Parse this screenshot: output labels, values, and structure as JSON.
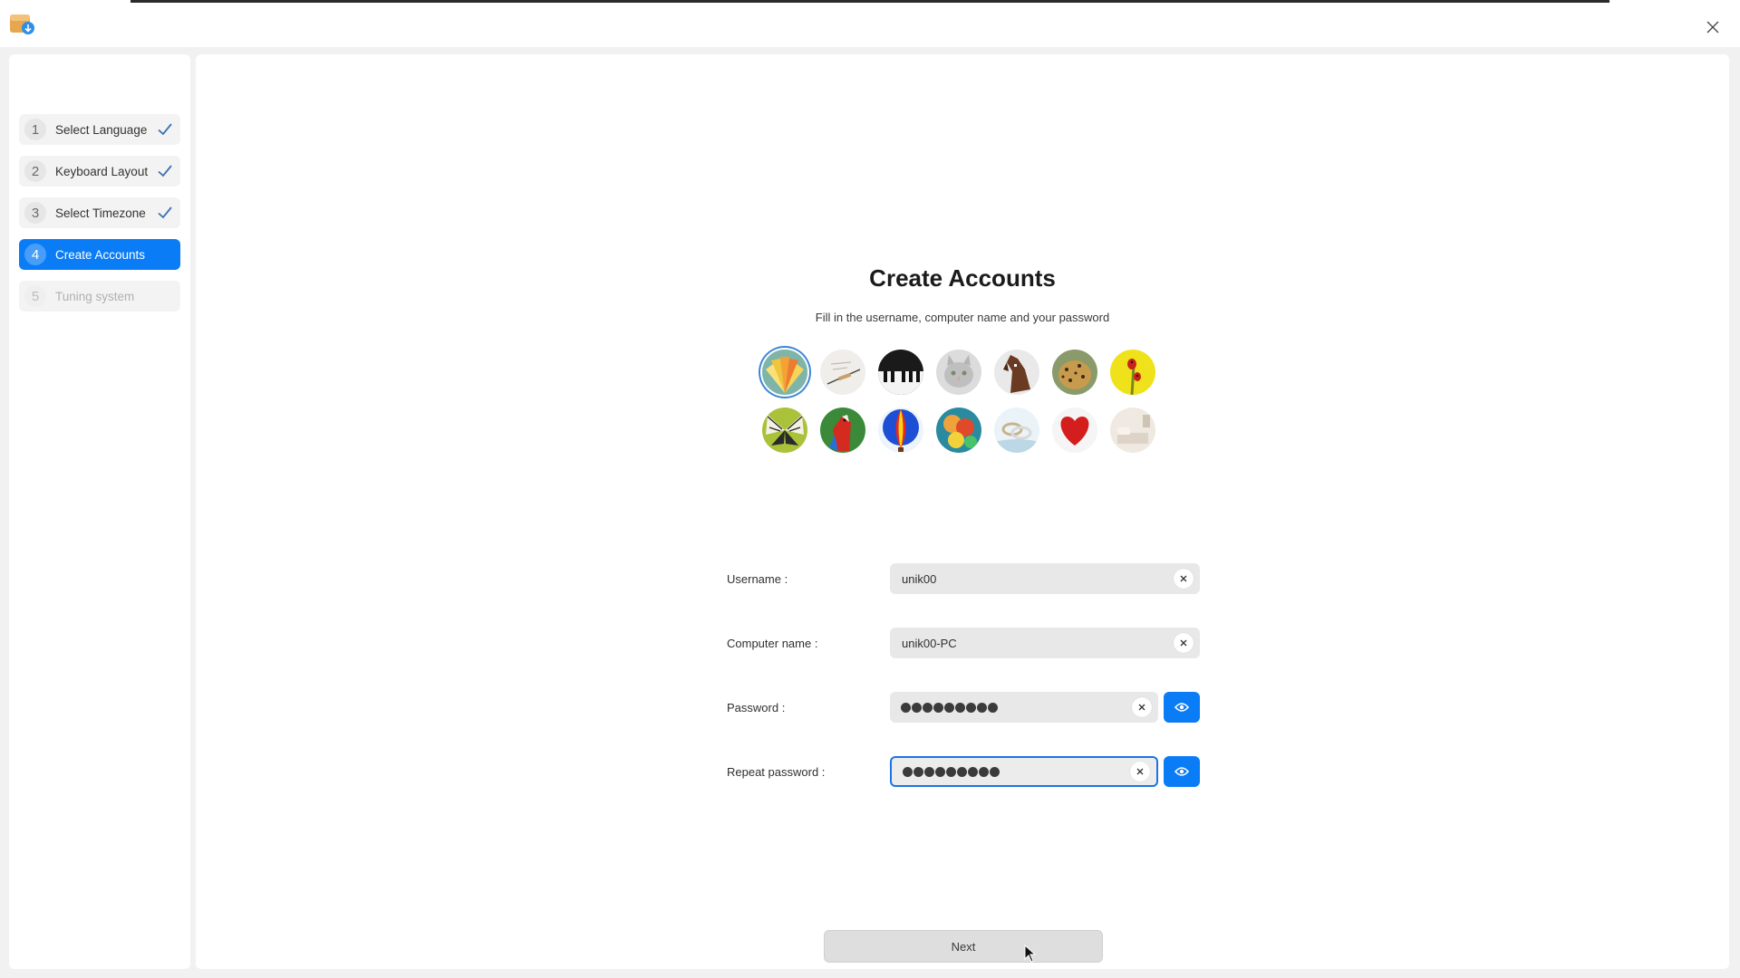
{
  "titlebar": {
    "app_icon": "installer-package-icon",
    "close_icon": "close-icon"
  },
  "steps": [
    {
      "num": "1",
      "label": "Select Language",
      "state": "done"
    },
    {
      "num": "2",
      "label": "Keyboard Layout",
      "state": "done"
    },
    {
      "num": "3",
      "label": "Select Timezone",
      "state": "done"
    },
    {
      "num": "4",
      "label": "Create Accounts",
      "state": "active"
    },
    {
      "num": "5",
      "label": "Tuning system",
      "state": "disabled"
    }
  ],
  "main": {
    "title": "Create Accounts",
    "subtitle": "Fill in the username, computer name and your password",
    "avatars": [
      {
        "name": "flower",
        "selected": true
      },
      {
        "name": "sketch"
      },
      {
        "name": "piano"
      },
      {
        "name": "cat"
      },
      {
        "name": "horse"
      },
      {
        "name": "leopard"
      },
      {
        "name": "ladybug"
      },
      {
        "name": "butterfly"
      },
      {
        "name": "parrot"
      },
      {
        "name": "hot-air-balloon"
      },
      {
        "name": "balloons"
      },
      {
        "name": "rings"
      },
      {
        "name": "heart"
      },
      {
        "name": "bedroom"
      }
    ]
  },
  "form": {
    "username_label": "Username :",
    "username_value": "unik00",
    "computer_label": "Computer name :",
    "computer_value": "unik00-PC",
    "password_label": "Password :",
    "repeat_label": "Repeat password :",
    "password_length": 9
  },
  "next_label": "Next",
  "colors": {
    "accent": "#0a7cf6",
    "focus_border": "#1a74e8"
  }
}
